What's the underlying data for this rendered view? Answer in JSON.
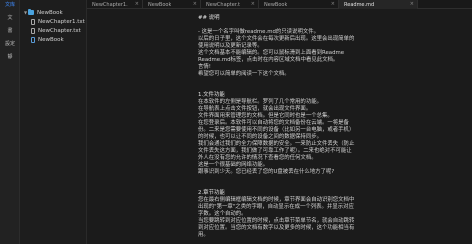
{
  "rail": {
    "items": [
      {
        "label": "文库",
        "active": true
      },
      {
        "label": "文"
      },
      {
        "label": "書"
      },
      {
        "label": "設定"
      },
      {
        "label": "靜"
      }
    ]
  },
  "tree": {
    "root": {
      "label": "NewBook"
    },
    "files": [
      {
        "label": "NewChapter1.txt"
      },
      {
        "label": "NewChapter.txt"
      },
      {
        "label": "NewBook",
        "selected": true
      }
    ]
  },
  "tabs": [
    {
      "label": "NewChapter1.",
      "close": "×"
    },
    {
      "label": "NewBook",
      "close": "×"
    },
    {
      "label": "NewChapter.t",
      "close": "×"
    },
    {
      "label": "NewBook",
      "close": "×"
    },
    {
      "label": "Readme.md",
      "close": "×",
      "active": true
    }
  ],
  "document": {
    "lines": [
      "## 说明",
      "",
      "- 这是一个名字叫做readme.md的只读说明文件。",
      "以后的日子里，这个文件会在每次更新后出现。这里会出现简单的",
      "使用说明以及更新记录等。",
      "这个文档基本不能编辑的。您可以鼠标滑到上面看到Readme",
      "Readme.md标签，点击时在内容区域文档中看见此文档。",
      "言情!",
      "希望您可以简单的阅读一下这个文档。",
      "",
      "1.文件功能",
      "在本软件的左侧是导航栏。罗列了几个常用的功能。",
      "在导航表上点击文件按钮，就会出现文件界面。",
      "文件界面用来管理您的文档。但是它同时也是一个总集。",
      "在您登录后。本软件可以自动将您的文档备份在云端。一将是备",
      "份。二来是您需要使用不同的设备（比如另一台电脑，或者手机）",
      "的时候，也可以让不同的设备之间的数据保持同步。",
      "我们会通过我们的全力保障数据的安全。一来防止文件丢失（防止",
      "文件丢失这方面，我们做了可靠工作了呢）。二来也绝对不可能让",
      "外人在没有您的允许的情况下查看您的任何文档。",
      "这是一个很基础的网络功能。",
      "跟事识到少天。您已经丢了您的U盘被丢在什么地方了呢?",
      "",
      "2.章节功能",
      "您在最右侧编辑框编辑文档的时候，章节界面会自动识别您文档中",
      "出现的\"第一章\"之类的字眼，自动显示在成一个列表。并显示对应",
      "字数。这个自动的。",
      "当您要跳转到对应位置的时候，点击章节菜单节名，就会自动跳转",
      "到对应位置。当您的文档有数字以及更多的时候，这个功能相当有",
      "用。"
    ]
  }
}
